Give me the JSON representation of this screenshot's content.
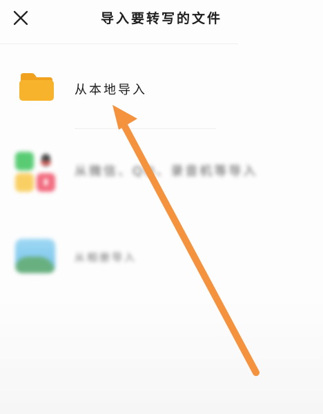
{
  "header": {
    "title": "导入要转写的文件",
    "close_icon": "close-x-icon"
  },
  "options": [
    {
      "label": "从本地导入",
      "icon": "folder-icon"
    },
    {
      "label": "从微信、QQ、录音机等导入",
      "icon": "wechat-qq-apps-icon"
    },
    {
      "label": "从相册导入",
      "icon": "photo-album-icon"
    }
  ],
  "colors": {
    "folder": "#F7B32B",
    "folder_tab": "#F0A11E",
    "wechat": "#3DC45C",
    "qq": "#2B2B2B",
    "recorder": "#F9C84A",
    "red_app": "#F0546A",
    "arrow": "#F5923E",
    "divider": "#EEEEEE"
  },
  "annotation": {
    "arrow_icon": "pointer-arrow-icon"
  }
}
